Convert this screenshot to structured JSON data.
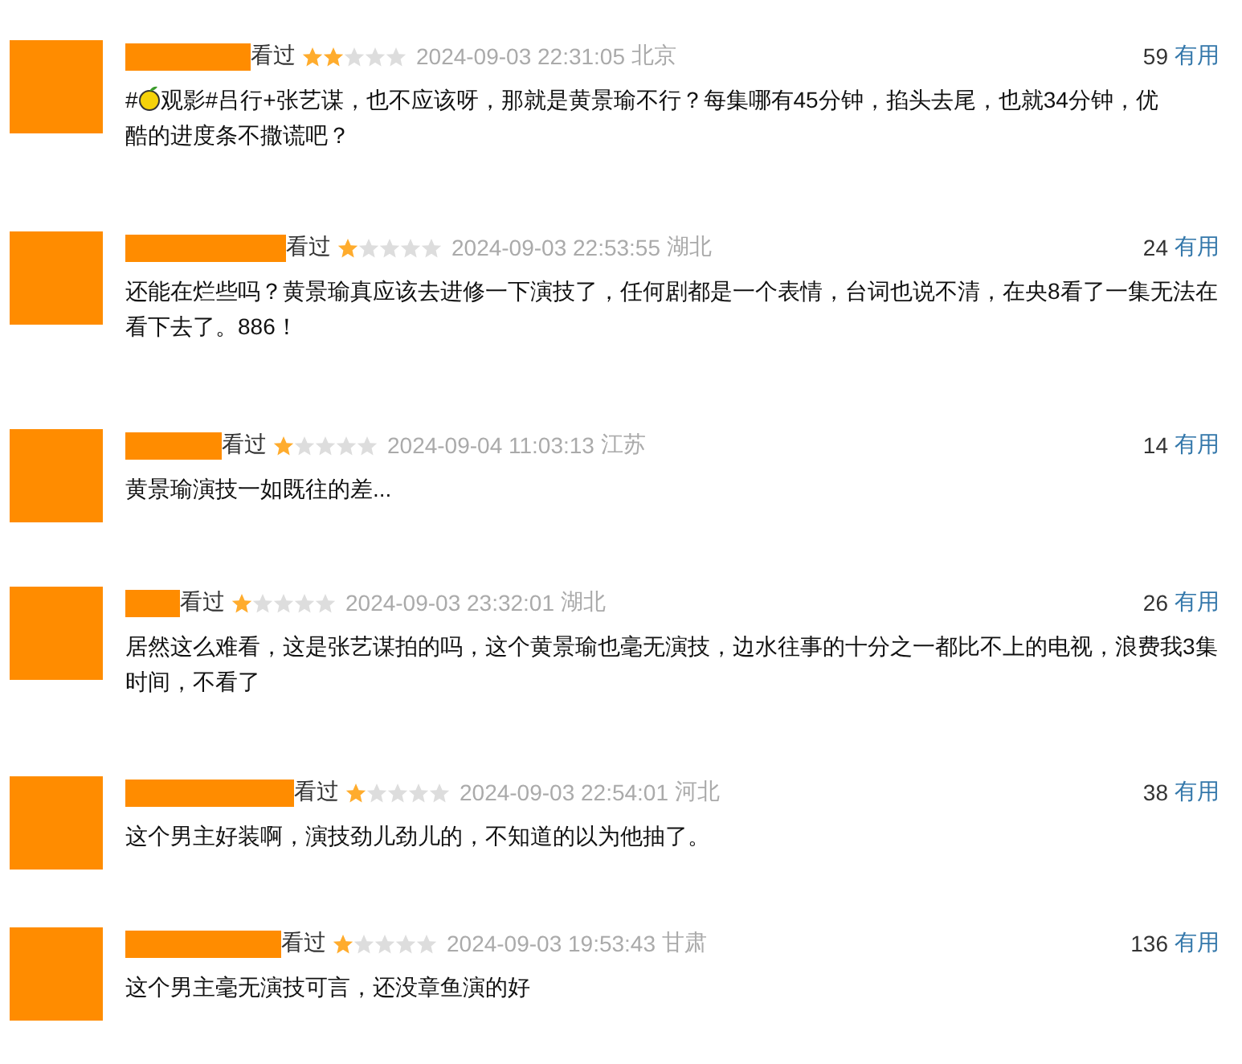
{
  "reviews": [
    {
      "status": "看过",
      "stars": 2,
      "time": "2024-09-03 22:31:05",
      "location": "北京",
      "votes": "59",
      "vote_label": "有用",
      "comment": [
        {
          "kind": "text",
          "text": "#"
        },
        {
          "kind": "emoji"
        },
        {
          "kind": "text",
          "text": "观影#吕行+张艺谋，也不应该呀，那就是黄景瑜不行？每集哪有45分钟，掐头去尾，也就34分钟，优"
        },
        {
          "kind": "line",
          "text": "酷的进度条不撒谎吧？"
        }
      ]
    },
    {
      "status": "看过",
      "stars": 1,
      "time": "2024-09-03 22:53:55",
      "location": "湖北",
      "votes": "24",
      "vote_label": "有用",
      "comment": [
        {
          "kind": "text",
          "text": "还能在烂些吗？黄景瑜真应该去进修一下演技了，任何剧都是一个表情，台词也说不清，在央8看了一集无法在看下去了。886！"
        }
      ]
    },
    {
      "status": "看过",
      "stars": 1,
      "time": "2024-09-04 11:03:13",
      "location": "江苏",
      "votes": "14",
      "vote_label": "有用",
      "comment": [
        {
          "kind": "text",
          "text": "黄景瑜演技一如既往的差..."
        }
      ]
    },
    {
      "status": "看过",
      "stars": 1,
      "time": "2024-09-03 23:32:01",
      "location": "湖北",
      "votes": "26",
      "vote_label": "有用",
      "comment": [
        {
          "kind": "text",
          "text": "居然这么难看，这是张艺谋拍的吗，这个黄景瑜也毫无演技，边水往事的十分之一都比不上的电视，浪费我3集时间，不看了"
        }
      ]
    },
    {
      "status": "看过",
      "stars": 1,
      "time": "2024-09-03 22:54:01",
      "location": "河北",
      "votes": "38",
      "vote_label": "有用",
      "comment": [
        {
          "kind": "text",
          "text": "这个男主好装啊，演技劲儿劲儿的，不知道的以为他抽了。"
        }
      ]
    },
    {
      "status": "看过",
      "stars": 1,
      "time": "2024-09-03 19:53:43",
      "location": "甘肃",
      "votes": "136",
      "vote_label": "有用",
      "comment": [
        {
          "kind": "text",
          "text": "这个男主毫无演技可言，还没章鱼演的好"
        }
      ]
    }
  ]
}
